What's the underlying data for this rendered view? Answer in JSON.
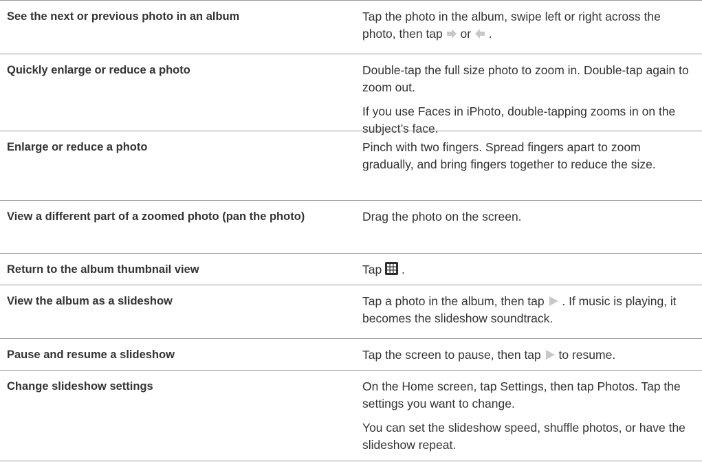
{
  "rows": [
    {
      "task": "See the next or previous photo in an album",
      "desc": [
        {
          "pre": "Tap the photo in the album, swipe left or right across the photo, then tap ",
          "mid": " or ",
          "post": " ."
        }
      ],
      "icons": [
        "right-arrow-icon",
        "left-arrow-icon"
      ]
    },
    {
      "task": "Quickly enlarge or reduce a photo",
      "desc": [
        {
          "text": "Double-tap the full size photo to zoom in. Double-tap again to zoom out."
        },
        {
          "text": "If you use Faces in iPhoto, double-tapping zooms in on the subject’s face."
        }
      ]
    },
    {
      "task": "Enlarge or reduce a photo",
      "desc": [
        {
          "text": "Pinch with two fingers. Spread fingers apart to zoom gradually, and bring fingers together to reduce the size."
        }
      ]
    },
    {
      "task": "View a different part of a zoomed photo (pan the photo)",
      "desc": [
        {
          "text": "Drag the photo on the screen."
        }
      ]
    },
    {
      "task": "Return to the album thumbnail view",
      "desc": [
        {
          "pre": "Tap ",
          "post": " ."
        }
      ],
      "icons": [
        "thumbnail-grid-icon"
      ]
    },
    {
      "task": "View the album as a slideshow",
      "desc": [
        {
          "pre": "Tap a photo in the album, then tap ",
          "post": " . If music is playing, it becomes the slideshow soundtrack."
        }
      ],
      "icons": [
        "play-icon"
      ]
    },
    {
      "task": "Pause and resume a slideshow",
      "desc": [
        {
          "pre": "Tap the screen to pause, then tap ",
          "post": " to resume."
        }
      ],
      "icons": [
        "play-icon"
      ]
    },
    {
      "task": "Change slideshow settings",
      "desc": [
        {
          "text": "On the Home screen, tap Settings, then tap Photos. Tap the settings you want to change."
        },
        {
          "text": "You can set the slideshow speed, shuffle photos, or have the slideshow repeat."
        }
      ]
    }
  ],
  "colors": {
    "rule": "#9a9a9a",
    "text": "#333333",
    "icon": "#c8c8c8",
    "grid_icon": "#2d2d2d"
  }
}
